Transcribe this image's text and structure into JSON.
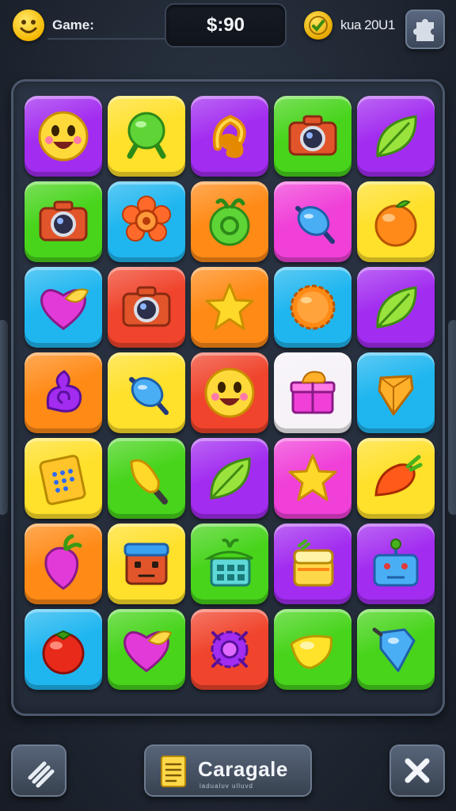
{
  "header": {
    "game_label": "Game:",
    "score": "$:90",
    "level_label": "kua 20U1"
  },
  "board": {
    "rows": 7,
    "cols": 5,
    "tiles": [
      [
        "purple",
        "smiley-face-icon"
      ],
      [
        "yellow",
        "green-lollipop-icon"
      ],
      [
        "purple",
        "orange-ribbon-icon"
      ],
      [
        "green",
        "camera-icon"
      ],
      [
        "purple",
        "leaf-icon"
      ],
      [
        "green",
        "camera-icon"
      ],
      [
        "cyan",
        "orange-flower-icon"
      ],
      [
        "orange",
        "green-apple-icon"
      ],
      [
        "magenta",
        "blue-lollipop-icon"
      ],
      [
        "yellow",
        "orange-fruit-icon"
      ],
      [
        "cyan",
        "heart-icon"
      ],
      [
        "red",
        "camera-icon"
      ],
      [
        "orange",
        "star-icon"
      ],
      [
        "cyan",
        "orange-cookie-icon"
      ],
      [
        "purple",
        "leaf-icon"
      ],
      [
        "orange",
        "purple-swirl-icon"
      ],
      [
        "yellow",
        "blue-lollipop-icon"
      ],
      [
        "red",
        "smiley-face-icon"
      ],
      [
        "white",
        "gift-box-icon"
      ],
      [
        "cyan",
        "orange-gem-icon"
      ],
      [
        "yellow",
        "calculator-icon"
      ],
      [
        "green",
        "yellow-popsicle-icon"
      ],
      [
        "purple",
        "leaf-icon"
      ],
      [
        "magenta",
        "star-icon"
      ],
      [
        "yellow",
        "carrot-icon"
      ],
      [
        "orange",
        "radish-icon"
      ],
      [
        "yellow",
        "robot-face-icon"
      ],
      [
        "green",
        "basket-icon"
      ],
      [
        "purple",
        "cake-icon"
      ],
      [
        "purple",
        "robot-icon"
      ],
      [
        "cyan",
        "tomato-icon"
      ],
      [
        "green",
        "heart-icon"
      ],
      [
        "red",
        "purple-flower-icon"
      ],
      [
        "green",
        "lemon-icon"
      ],
      [
        "green",
        "blue-gem-icon"
      ]
    ]
  },
  "colors": {
    "purple": "#a22cf0",
    "yellow": "#ffe02a",
    "green": "#47d41b",
    "cyan": "#1fb6f0",
    "orange": "#ff8a16",
    "magenta": "#f040d8",
    "red": "#f0442c",
    "white": "#f6f2f8"
  },
  "footer": {
    "action_label": "Caragale",
    "action_sub": "ladualuv ulluvd"
  },
  "icons": {
    "avatar": "smiley-face-icon",
    "coin": "coin-icon",
    "puzzle": "puzzle-piece-icon",
    "menu": "menu-icon",
    "close": "close-icon",
    "doc": "document-icon"
  }
}
